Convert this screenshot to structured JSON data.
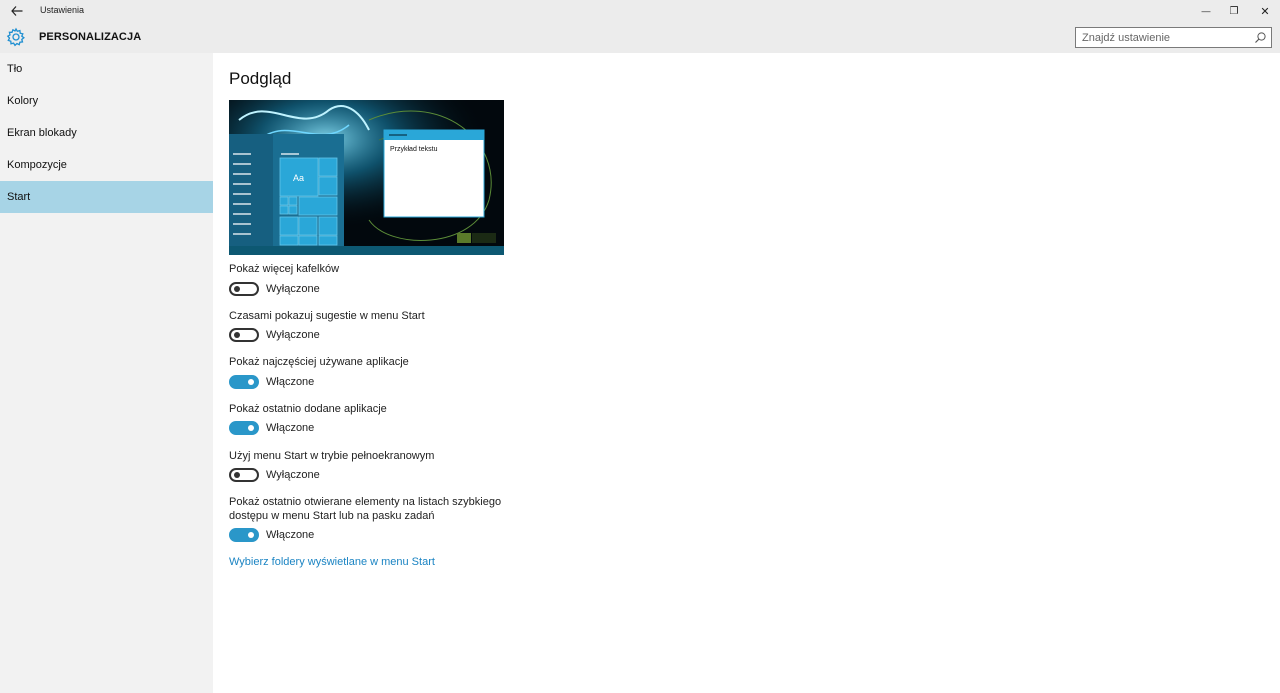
{
  "window": {
    "title": "Ustawienia",
    "controls": {
      "minimize": "—",
      "restore": "❐",
      "close": "✕"
    }
  },
  "header": {
    "section_title": "PERSONALIZACJA",
    "icon": "gear-icon",
    "search": {
      "placeholder": "Znajdź ustawienie",
      "value": ""
    }
  },
  "sidebar": {
    "items": [
      {
        "label": "Tło",
        "selected": false
      },
      {
        "label": "Kolory",
        "selected": false
      },
      {
        "label": "Ekran blokady",
        "selected": false
      },
      {
        "label": "Kompozycje",
        "selected": false
      },
      {
        "label": "Start",
        "selected": true
      }
    ]
  },
  "main": {
    "heading": "Podgląd",
    "preview": {
      "tile_text": "Aa",
      "sample_text": "Przykład tekstu"
    },
    "settings": [
      {
        "label": "Pokaż więcej kafelków",
        "state": "Wyłączone",
        "on": false
      },
      {
        "label": "Czasami pokazuj sugestie w menu Start",
        "state": "Wyłączone",
        "on": false
      },
      {
        "label": "Pokaż najczęściej używane aplikacje",
        "state": "Włączone",
        "on": true
      },
      {
        "label": "Pokaż ostatnio dodane aplikacje",
        "state": "Włączone",
        "on": true
      },
      {
        "label": "Użyj menu Start w trybie pełnoekranowym",
        "state": "Wyłączone",
        "on": false
      },
      {
        "label": "Pokaż ostatnio otwierane elementy na listach szybkiego dostępu w menu Start lub na pasku zadań",
        "state": "Włączone",
        "on": true
      }
    ],
    "link": "Wybierz foldery wyświetlane w menu Start"
  },
  "colors": {
    "accent": "#2a97c9",
    "selected_nav": "#a7d4e6",
    "link": "#1b84c3",
    "chrome": "#ececec"
  }
}
